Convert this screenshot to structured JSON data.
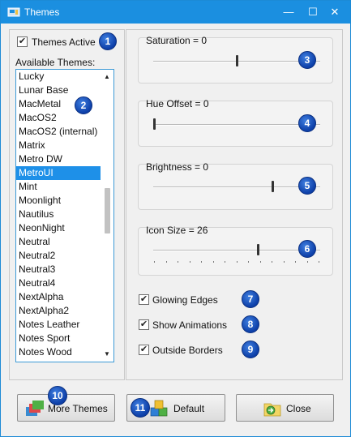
{
  "window": {
    "title": "Themes",
    "controls": {
      "minimize": "—",
      "maximize": "☐",
      "close": "✕"
    }
  },
  "themes_active": {
    "label": "Themes Active",
    "checked": true
  },
  "list": {
    "header": "Available Themes:",
    "items": [
      "Lucky",
      "Lunar Base",
      "MacMetal",
      "MacOS2",
      "MacOS2 (internal)",
      "Matrix",
      "Metro DW",
      "MetroUI",
      "Mint",
      "Moonlight",
      "Nautilus",
      "NeonNight",
      "Neutral",
      "Neutral2",
      "Neutral3",
      "Neutral4",
      "NextAlpha",
      "NextAlpha2",
      "Notes Leather",
      "Notes Sport",
      "Notes Wood"
    ],
    "selected": "MetroUI"
  },
  "sliders": {
    "saturation": {
      "label": "Saturation = 0",
      "fraction": 0.5
    },
    "hue_offset": {
      "label": "Hue Offset = 0",
      "fraction": 0.0
    },
    "brightness": {
      "label": "Brightness = 0",
      "fraction": 0.72
    },
    "icon_size": {
      "label": "Icon Size = 26",
      "fraction": 0.63
    }
  },
  "options": {
    "glowing_edges": {
      "label": "Glowing Edges",
      "checked": true
    },
    "show_animations": {
      "label": "Show Animations",
      "checked": true
    },
    "outside_borders": {
      "label": "Outside Borders",
      "checked": true
    }
  },
  "buttons": {
    "more_themes": "More Themes",
    "default": "Default",
    "close": "Close"
  },
  "badges": [
    "1",
    "2",
    "3",
    "4",
    "5",
    "6",
    "7",
    "8",
    "9",
    "10",
    "11"
  ],
  "colors": {
    "title_bar": "#1b8fe0",
    "selection": "#1e90e8",
    "badge": "#1248b8"
  }
}
